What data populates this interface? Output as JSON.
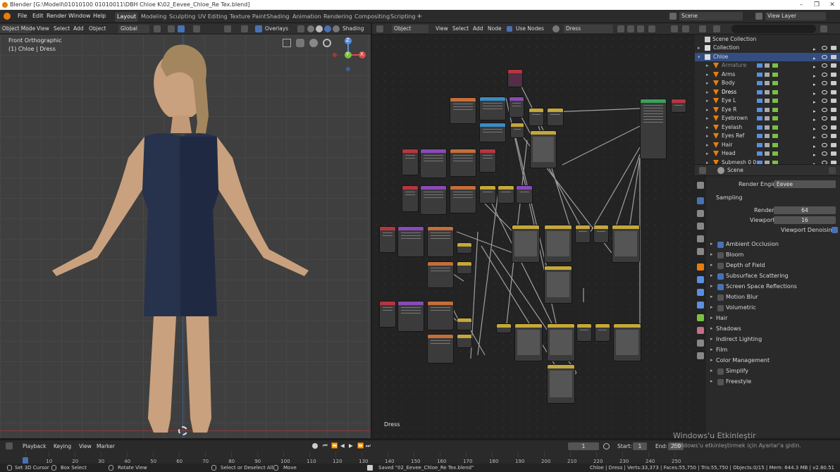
{
  "window": {
    "title": "Blender [G:\\Modell\\01010100 01010011\\DBH Chloe K\\02_Eevee_Chloe_Re Tex.blend]"
  },
  "menus": [
    "File",
    "Edit",
    "Render",
    "Window",
    "Help"
  ],
  "workspace_tabs": [
    "Layout",
    "Modeling",
    "Sculpting",
    "UV Editing",
    "Texture Paint",
    "Shading",
    "Animation",
    "Rendering",
    "Compositing",
    "Scripting"
  ],
  "active_tab": "Layout",
  "scene": {
    "label": "Scene",
    "view_layer": "View Layer"
  },
  "viewport_header": {
    "mode": "Object Mode",
    "view": "View",
    "select": "Select",
    "add": "Add",
    "object": "Object",
    "orientation": "Global",
    "overlays": "Overlays",
    "shading": "Shading"
  },
  "viewport": {
    "view_name": "Front Orthographic",
    "object_info": "(1) Chloe | Dress",
    "gizmo": {
      "z": "Z",
      "y": "Y",
      "x": "X"
    }
  },
  "node_header": {
    "object": "Object",
    "view": "View",
    "select": "Select",
    "add": "Add",
    "node": "Node",
    "use_nodes": "Use Nodes",
    "material": "Dress"
  },
  "node_editor": {
    "material_label": "Dress"
  },
  "outliner": {
    "collection_title": "Scene Collection",
    "items": [
      {
        "name": "Collection",
        "indent": 1
      },
      {
        "name": "Chloe",
        "indent": 1,
        "selected": true
      },
      {
        "name": "Armature",
        "indent": 2,
        "dim": true
      },
      {
        "name": "Arms",
        "indent": 2
      },
      {
        "name": "Body",
        "indent": 2
      },
      {
        "name": "Dress",
        "indent": 2,
        "bright": true
      },
      {
        "name": "Eye L",
        "indent": 2
      },
      {
        "name": "Eye R",
        "indent": 2
      },
      {
        "name": "Eyebrown",
        "indent": 2
      },
      {
        "name": "Eyelash",
        "indent": 2
      },
      {
        "name": "Eyes Ref",
        "indent": 2
      },
      {
        "name": "Hair",
        "indent": 2
      },
      {
        "name": "Head",
        "indent": 2
      },
      {
        "name": "Submesh 0 0",
        "indent": 2
      }
    ]
  },
  "properties": {
    "context": "Scene",
    "render_engine_label": "Render Engine",
    "render_engine": "Eevee",
    "sampling": "Sampling",
    "render_label": "Render",
    "render_value": "64",
    "viewport_label": "Viewport",
    "viewport_value": "16",
    "viewport_denoising": "Viewport Denoising",
    "panels": [
      {
        "label": "Ambient Occlusion",
        "checkbox": true,
        "checked": true
      },
      {
        "label": "Bloom",
        "checkbox": true,
        "checked": false
      },
      {
        "label": "Depth of Field",
        "checkbox": true,
        "checked": false
      },
      {
        "label": "Subsurface Scattering",
        "checkbox": true,
        "checked": true
      },
      {
        "label": "Screen Space Reflections",
        "checkbox": true,
        "checked": true
      },
      {
        "label": "Motion Blur",
        "checkbox": true,
        "checked": false
      },
      {
        "label": "Volumetric",
        "checkbox": true,
        "checked": false
      },
      {
        "label": "Hair",
        "checkbox": false
      },
      {
        "label": "Shadows",
        "checkbox": false
      },
      {
        "label": "Indirect Lighting",
        "checkbox": false
      },
      {
        "label": "Film",
        "checkbox": false
      },
      {
        "label": "Color Management",
        "checkbox": false
      },
      {
        "label": "Simplify",
        "checkbox": true,
        "checked": false
      },
      {
        "label": "Freestyle",
        "checkbox": true,
        "checked": false
      }
    ]
  },
  "timeline": {
    "playback": "Playback",
    "keying": "Keying",
    "view": "View",
    "marker": "Marker",
    "current_frame": "1",
    "start_label": "Start:",
    "start": "1",
    "end_label": "End:",
    "end": "250",
    "ticks": [
      "1",
      "10",
      "20",
      "30",
      "40",
      "50",
      "60",
      "70",
      "80",
      "90",
      "100",
      "110",
      "120",
      "130",
      "140",
      "150",
      "160",
      "170",
      "180",
      "190",
      "200",
      "210",
      "220",
      "230",
      "240",
      "250"
    ]
  },
  "watermark": {
    "line1": "Windows'u Etkinleştir",
    "line2": "Windows'u etkinleştirmek için Ayarlar'a gidin."
  },
  "statusbar": {
    "set_cursor": "Set 3D Cursor",
    "box_select": "Box Select",
    "rotate_view": "Rotate View",
    "select_deselect": "Select or Deselect All",
    "move": "Move",
    "saved": "Saved \"02_Eevee_Chloe_Re Tex.blend\"",
    "stats": "Chloe | Dress | Verts:33,373 | Faces:55,750 | Tris:55,750 | Objects:0/15 | Mem: 644.3 MB | v2.80.51"
  },
  "colors": {
    "accent": "#4772b3",
    "selected_row": "#334d80",
    "blender_orange": "#e87d0d"
  }
}
